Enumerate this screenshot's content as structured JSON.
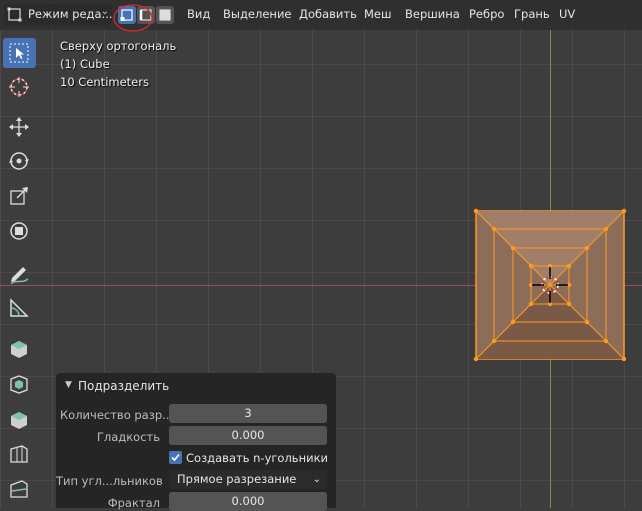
{
  "header": {
    "mode_label": "Режим реда...",
    "menus": [
      "Вид",
      "Выделение",
      "Добавить",
      "Меш",
      "Вершина",
      "Ребро",
      "Грань",
      "UV"
    ],
    "select_modes": [
      "vertex-select-icon",
      "edge-select-icon",
      "face-select-icon"
    ]
  },
  "overlay": {
    "view_name": "Сверху ортогональ",
    "object_name": "(1) Cube",
    "grid_scale": "10 Centimeters"
  },
  "toolbar": {
    "tools": [
      "select-box-icon",
      "cursor-icon",
      "move-icon",
      "rotate-icon",
      "scale-icon",
      "transform-icon",
      "annotate-icon",
      "measure-icon",
      "add-cube-icon",
      "extrude-icon",
      "inset-icon",
      "bevel-icon",
      "loop-cut-icon"
    ]
  },
  "operator_panel": {
    "title": "Подразделить",
    "number_of_cuts_label": "Количество разр...",
    "number_of_cuts_value": "3",
    "smoothness_label": "Гладкость",
    "smoothness_value": "0.000",
    "create_ngons_label": "Создавать n-угольники",
    "create_ngons_checked": true,
    "corner_type_label": "Тип угл...льников",
    "corner_type_value": "Прямое разрезание",
    "fractal_label": "Фрактал",
    "fractal_value": "0.000"
  },
  "colors": {
    "accent": "#4772b3",
    "selection": "#ff9a1f",
    "x_axis": "#a24a57",
    "y_axis": "#6c9a3a"
  }
}
